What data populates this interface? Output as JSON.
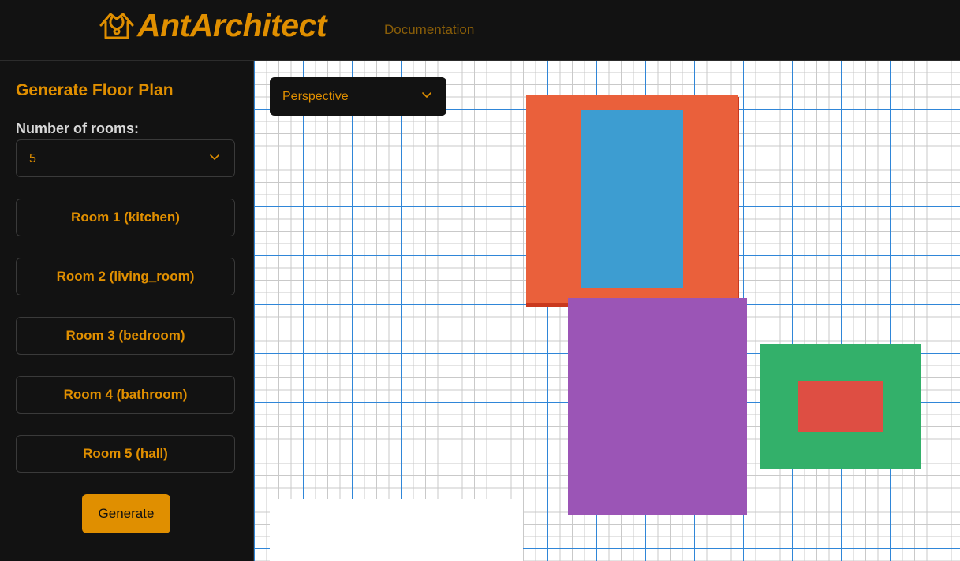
{
  "header": {
    "logo_text": "AntArchitect",
    "nav_documentation": "Documentation"
  },
  "sidebar": {
    "title": "Generate Floor Plan",
    "rooms_label": "Number of rooms:",
    "rooms_count": "5",
    "rooms": [
      {
        "label": "Room 1 (kitchen)"
      },
      {
        "label": "Room 2 (living_room)"
      },
      {
        "label": "Room 3 (bedroom)"
      },
      {
        "label": "Room 4 (bathroom)"
      },
      {
        "label": "Room 5 (hall)"
      }
    ],
    "generate_label": "Generate"
  },
  "canvas": {
    "view_mode": "Perspective"
  },
  "colors": {
    "accent": "#e08f00",
    "room_orange": "#ea603b",
    "room_blue": "#3d9dd1",
    "room_purple": "#9b55b6",
    "room_green": "#33b06a",
    "room_red": "#de4e43"
  },
  "icons": {
    "logo": "ant-house-icon",
    "dropdown": "chevron-down-icon"
  }
}
